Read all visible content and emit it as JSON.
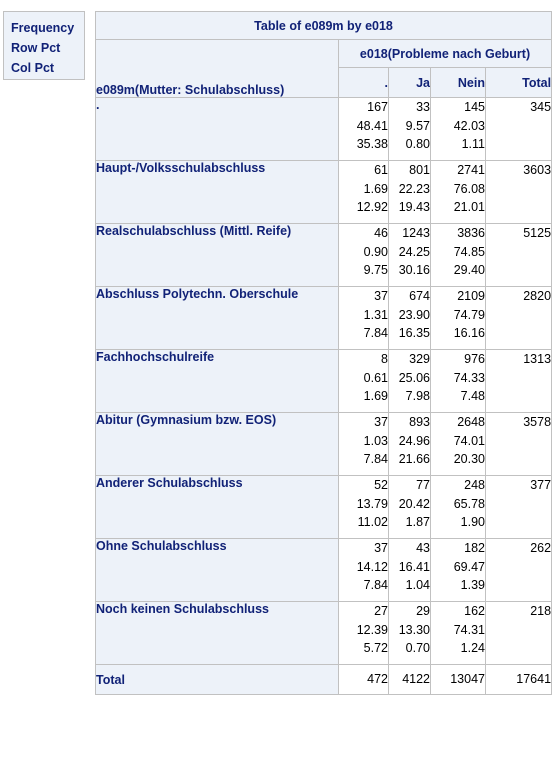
{
  "legend": [
    "Frequency",
    "Row Pct",
    "Col Pct"
  ],
  "table": {
    "title": "Table of e089m by e018",
    "col_variable": "e018(Probleme nach Geburt)",
    "row_variable": "e089m(Mutter: Schulabschluss)",
    "columns": [
      ".",
      "Ja",
      "Nein",
      "Total"
    ],
    "rows": [
      {
        "label": ".",
        "cells": [
          [
            "167",
            "48.41",
            "35.38"
          ],
          [
            "33",
            "9.57",
            "0.80"
          ],
          [
            "145",
            "42.03",
            "1.11"
          ],
          [
            "345"
          ]
        ]
      },
      {
        "label": "Haupt-/Volksschulabschluss",
        "cells": [
          [
            "61",
            "1.69",
            "12.92"
          ],
          [
            "801",
            "22.23",
            "19.43"
          ],
          [
            "2741",
            "76.08",
            "21.01"
          ],
          [
            "3603"
          ]
        ]
      },
      {
        "label": "Realschulabschluss (Mittl. Reife)",
        "cells": [
          [
            "46",
            "0.90",
            "9.75"
          ],
          [
            "1243",
            "24.25",
            "30.16"
          ],
          [
            "3836",
            "74.85",
            "29.40"
          ],
          [
            "5125"
          ]
        ]
      },
      {
        "label": "Abschluss Polytechn. Oberschule",
        "cells": [
          [
            "37",
            "1.31",
            "7.84"
          ],
          [
            "674",
            "23.90",
            "16.35"
          ],
          [
            "2109",
            "74.79",
            "16.16"
          ],
          [
            "2820"
          ]
        ]
      },
      {
        "label": "Fachhochschulreife",
        "cells": [
          [
            "8",
            "0.61",
            "1.69"
          ],
          [
            "329",
            "25.06",
            "7.98"
          ],
          [
            "976",
            "74.33",
            "7.48"
          ],
          [
            "1313"
          ]
        ]
      },
      {
        "label": "Abitur (Gymnasium bzw. EOS)",
        "cells": [
          [
            "37",
            "1.03",
            "7.84"
          ],
          [
            "893",
            "24.96",
            "21.66"
          ],
          [
            "2648",
            "74.01",
            "20.30"
          ],
          [
            "3578"
          ]
        ]
      },
      {
        "label": "Anderer Schulabschluss",
        "cells": [
          [
            "52",
            "13.79",
            "11.02"
          ],
          [
            "77",
            "20.42",
            "1.87"
          ],
          [
            "248",
            "65.78",
            "1.90"
          ],
          [
            "377"
          ]
        ]
      },
      {
        "label": "Ohne Schulabschluss",
        "cells": [
          [
            "37",
            "14.12",
            "7.84"
          ],
          [
            "43",
            "16.41",
            "1.04"
          ],
          [
            "182",
            "69.47",
            "1.39"
          ],
          [
            "262"
          ]
        ]
      },
      {
        "label": "Noch keinen Schulabschluss",
        "cells": [
          [
            "27",
            "12.39",
            "5.72"
          ],
          [
            "29",
            "13.30",
            "0.70"
          ],
          [
            "162",
            "74.31",
            "1.24"
          ],
          [
            "218"
          ]
        ]
      }
    ],
    "total_row": {
      "label": "Total",
      "cells": [
        "472",
        "4122",
        "13047",
        "17641"
      ]
    }
  }
}
